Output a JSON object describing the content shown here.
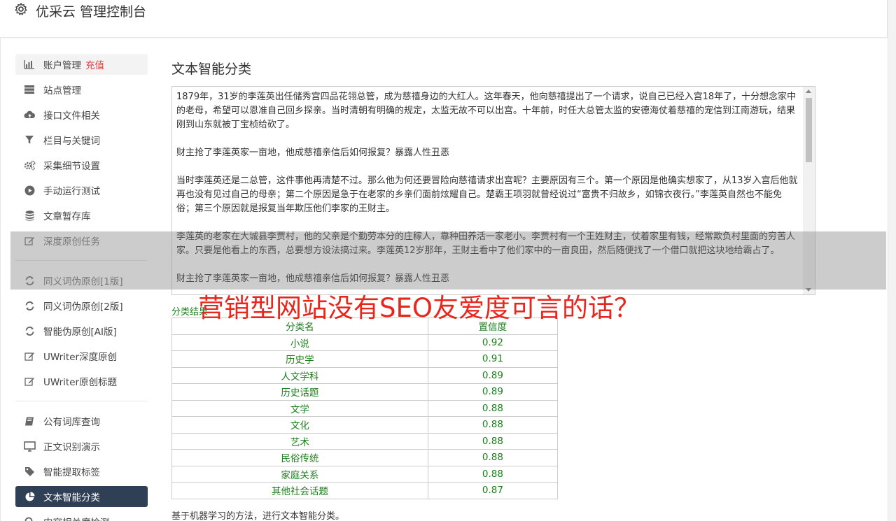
{
  "header": {
    "title": "优采云 管理控制台"
  },
  "sidebar": {
    "items": [
      {
        "label": "账户管理",
        "extra": "充值",
        "icon": "bar-chart-icon"
      },
      {
        "label": "站点管理",
        "icon": "server-icon"
      },
      {
        "label": "接口文件相关",
        "icon": "cloud-upload-icon"
      },
      {
        "label": "栏目与关键词",
        "icon": "filter-icon"
      },
      {
        "label": "采集细节设置",
        "icon": "cogs-icon"
      },
      {
        "label": "手动运行测试",
        "icon": "play-circle-icon"
      },
      {
        "label": "文章暂存库",
        "icon": "database-icon"
      },
      {
        "label": "深度原创任务",
        "icon": "edit-icon"
      },
      {
        "label": "同义词伪原创[1版]",
        "icon": "refresh-icon"
      },
      {
        "label": "同义词伪原创[2版]",
        "icon": "refresh-icon"
      },
      {
        "label": "智能伪原创[AI版]",
        "icon": "refresh-icon"
      },
      {
        "label": "UWriter深度原创",
        "icon": "edit-icon"
      },
      {
        "label": "UWriter原创标题",
        "icon": "edit-icon"
      },
      {
        "label": "公有词库查询",
        "icon": "book-icon"
      },
      {
        "label": "正文识别演示",
        "icon": "monitor-icon"
      },
      {
        "label": "智能提取标签",
        "icon": "tag-icon"
      },
      {
        "label": "文本智能分类",
        "icon": "pie-chart-icon"
      },
      {
        "label": "内容相关度检测",
        "icon": "search-icon"
      }
    ]
  },
  "main": {
    "title": "文本智能分类",
    "text": {
      "p1": "1879年，31岁的李莲英出任储秀宫四品花翎总管，成为慈禧身边的大红人。这年春天，他向慈禧提出了一个请求，说自己已经入宫18年了，十分想念家中的老母，希望可以恩准自己回乡探亲。当时清朝有明确的规定，太监无故不可以出宫。十年前，时任大总管太监的安德海仗着慈禧的宠信到江南游玩，结果刚到山东就被丁宝桢给砍了。",
      "p2": "财主抢了李莲英家一亩地，他成慈禧亲信后如何报复？暴露人性丑恶",
      "p3": "当时李莲英还是二总管，这件事他再清楚不过。那么他为何还要冒险向慈禧请求出宫呢？主要原因有三个。第一个原因是他确实想家了，从13岁入宫后他就再也没有见过自己的母亲；第二个原因是急于在老家的乡亲们面前炫耀自己。楚霸王项羽就曾经说过“富贵不归故乡，如锦衣夜行。”李莲英自然也不能免俗；第三个原因就是报复当年欺压他们李家的王财主。",
      "p4": "李莲英的老家在大城县李贾村，他的父亲是个勤劳本分的庄稼人，靠种田养活一家老小。李贾村有一个王姓财主，仗着家里有钱，经常欺负村里面的穷苦人家。只要是他看上的东西，总要想方设法搞过来。李莲英12岁那年，王财主看中了他们家中的一亩良田，然后随便找了一个借口就把这块地给霸占了。",
      "p5": "财主抢了李莲英家一亩地，他成慈禧亲信后如何报复？暴露人性丑恶"
    },
    "result_label": "分类结果",
    "table": {
      "headers": [
        "分类名",
        "置信度"
      ],
      "rows": [
        [
          "小说",
          "0.92"
        ],
        [
          "历史学",
          "0.91"
        ],
        [
          "人文学科",
          "0.89"
        ],
        [
          "历史话题",
          "0.89"
        ],
        [
          "文学",
          "0.88"
        ],
        [
          "文化",
          "0.88"
        ],
        [
          "艺术",
          "0.88"
        ],
        [
          "民俗传统",
          "0.88"
        ],
        [
          "家庭关系",
          "0.88"
        ],
        [
          "其他社会话题",
          "0.87"
        ]
      ]
    },
    "description": "基于机器学习的方法，进行文本智能分类。"
  },
  "banner": {
    "text": "营销型网站没有SEO友爱度可言的话？"
  },
  "colors": {
    "active_nav_bg": "#2f4056",
    "result_green": "#1a7f1a",
    "banner_red": "#e8261c",
    "recharge_red": "#e4393c"
  }
}
